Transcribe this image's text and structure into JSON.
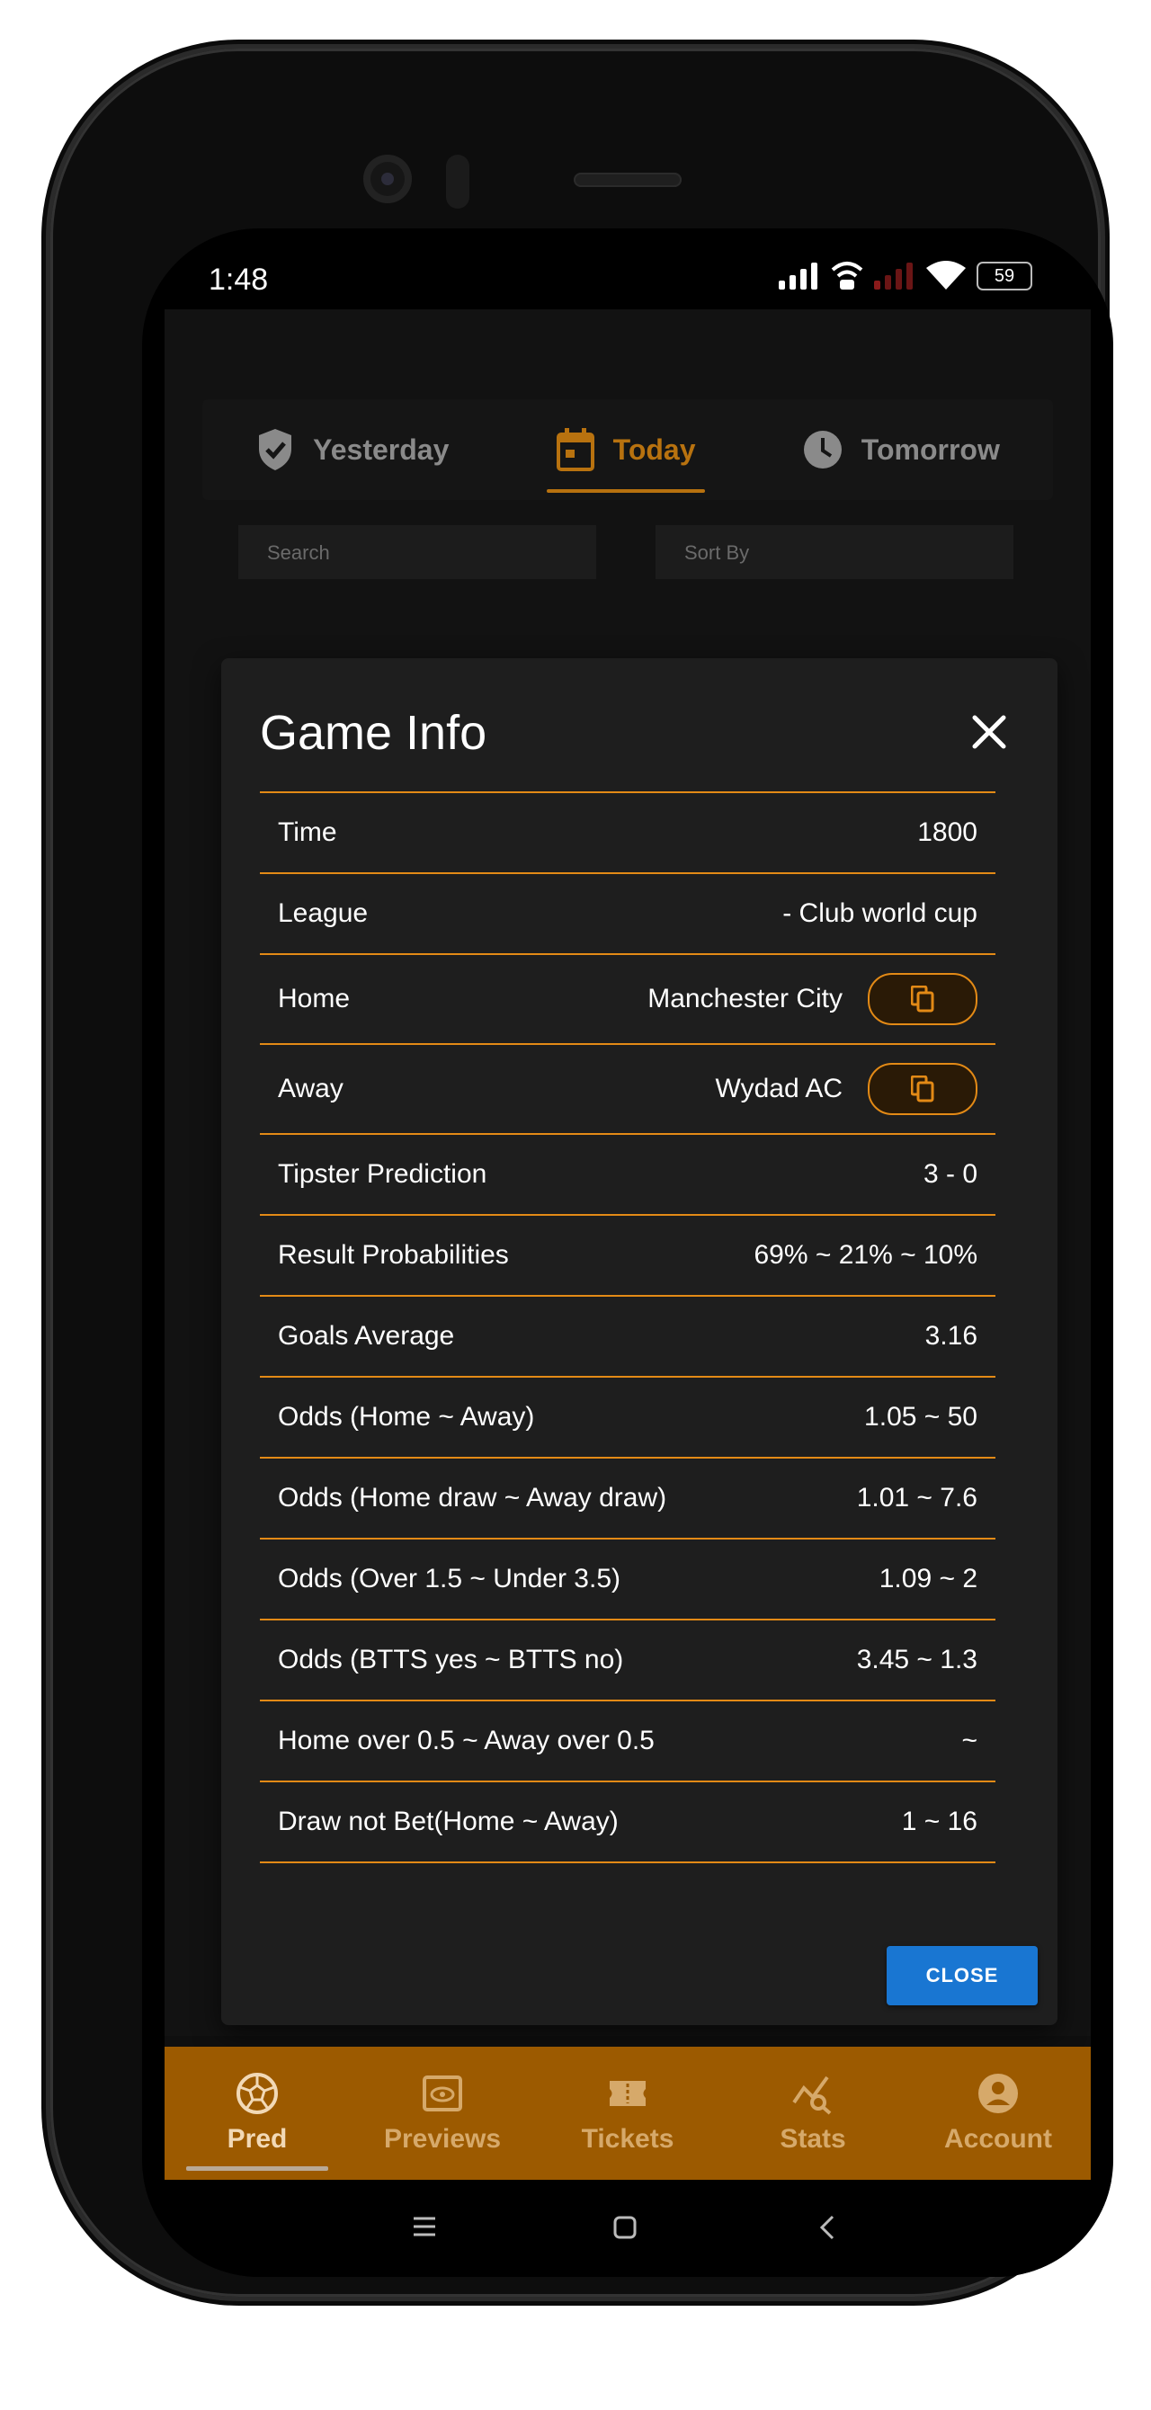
{
  "status_bar": {
    "time": "1:48",
    "battery": "59"
  },
  "tabs": [
    {
      "label": "Yesterday",
      "icon": "shield-check-icon"
    },
    {
      "label": "Today",
      "icon": "calendar-icon",
      "active": true
    },
    {
      "label": "Tomorrow",
      "icon": "clock-icon"
    }
  ],
  "filters": {
    "search_placeholder": "Search",
    "sort_label": "Sort By"
  },
  "dialog": {
    "title": "Game Info",
    "rows": [
      {
        "label": "Time",
        "value": "1800"
      },
      {
        "label": "League",
        "value": "- Club world cup"
      },
      {
        "label": "Home",
        "value": "Manchester City",
        "copy": true
      },
      {
        "label": "Away",
        "value": "Wydad AC",
        "copy": true
      },
      {
        "label": "Tipster Prediction",
        "value": "3 - 0"
      },
      {
        "label": "Result Probabilities",
        "value": "69% ~ 21% ~ 10%"
      },
      {
        "label": "Goals Average",
        "value": "3.16"
      },
      {
        "label": "Odds (Home ~ Away)",
        "value": "1.05 ~ 50"
      },
      {
        "label": "Odds (Home draw ~ Away draw)",
        "value": "1.01 ~ 7.6"
      },
      {
        "label": "Odds (Over 1.5 ~ Under 3.5)",
        "value": "1.09 ~ 2"
      },
      {
        "label": "Odds (BTTS yes ~ BTTS no)",
        "value": "3.45 ~ 1.3"
      },
      {
        "label": "Home over 0.5 ~ Away over 0.5",
        "value": "~"
      },
      {
        "label": "Draw not Bet(Home ~ Away)",
        "value": "1 ~ 16"
      }
    ],
    "close_label": "CLOSE"
  },
  "bottom_nav": [
    {
      "label": "Pred",
      "icon": "soccer-ball-icon",
      "active": true
    },
    {
      "label": "Previews",
      "icon": "preview-icon"
    },
    {
      "label": "Tickets",
      "icon": "ticket-icon"
    },
    {
      "label": "Stats",
      "icon": "stats-icon"
    },
    {
      "label": "Account",
      "icon": "account-icon"
    }
  ],
  "colors": {
    "accent": "#e38a16",
    "nav_bg": "#9c5a00",
    "button_blue": "#1976d2"
  }
}
